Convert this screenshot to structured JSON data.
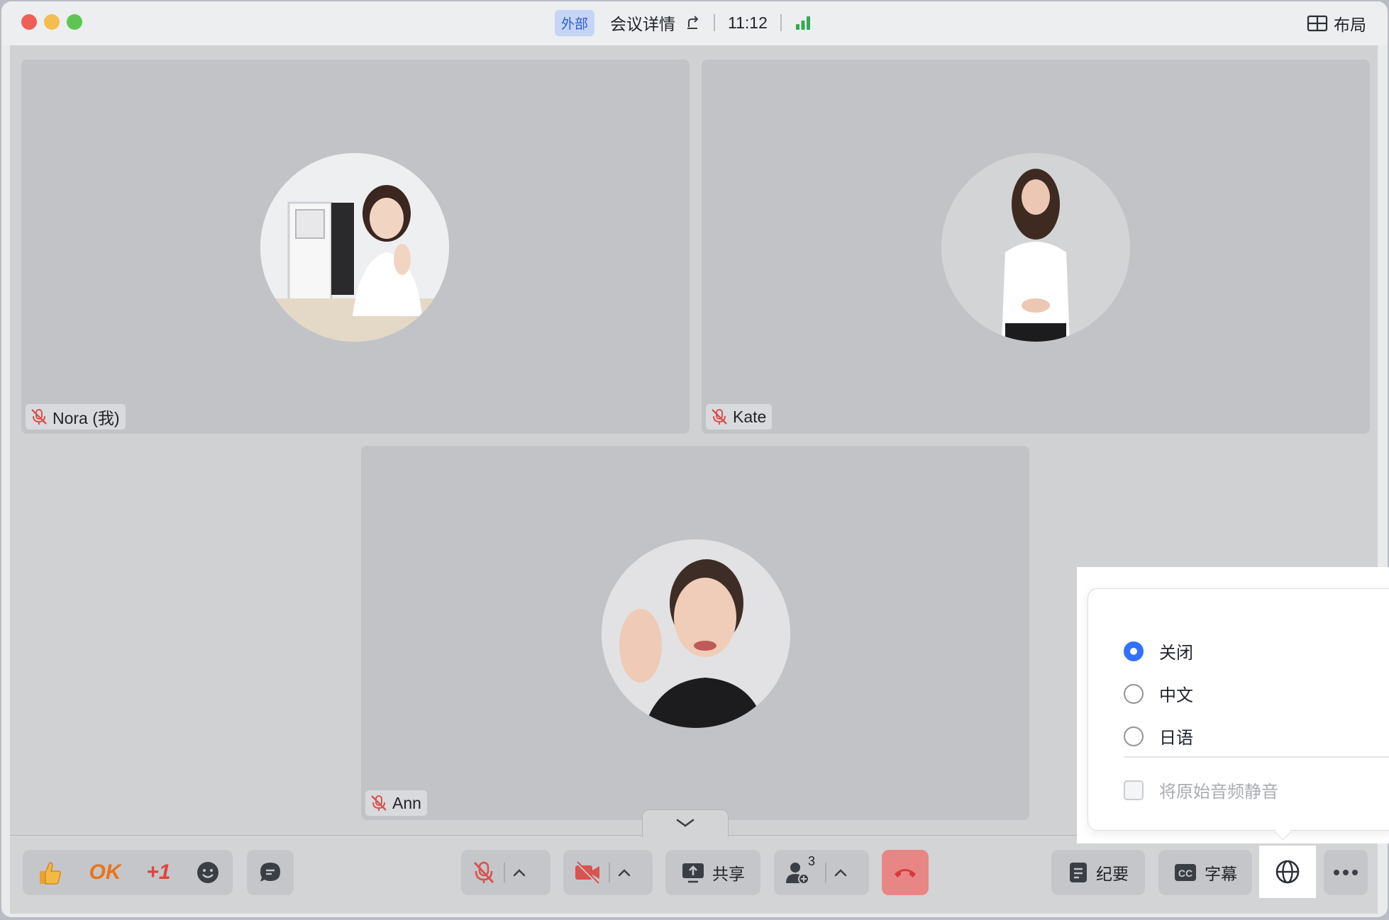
{
  "titlebar": {
    "badge": "外部",
    "meeting_details": "会议详情",
    "time": "11:12",
    "layout_label": "布局"
  },
  "participants": [
    {
      "name": "Nora (我)",
      "muted": true
    },
    {
      "name": "Kate",
      "muted": true
    },
    {
      "name": "Ann",
      "muted": true
    }
  ],
  "toolbar": {
    "reaction_ok": "OK",
    "reaction_plus_one": "+1",
    "share_label": "共享",
    "participants_count": "3",
    "minutes_label": "纪要",
    "captions_label": "字幕"
  },
  "translation_menu": {
    "options": [
      {
        "label": "关闭",
        "selected": true
      },
      {
        "label": "中文",
        "selected": false
      },
      {
        "label": "日语",
        "selected": false
      }
    ],
    "mute_original_label": "将原始音频静音",
    "mute_original_checked": false
  },
  "colors": {
    "accent": "#3370ff",
    "leave_button": "#e88686",
    "mic_muted": "#d9534f",
    "signal": "#34a853"
  }
}
